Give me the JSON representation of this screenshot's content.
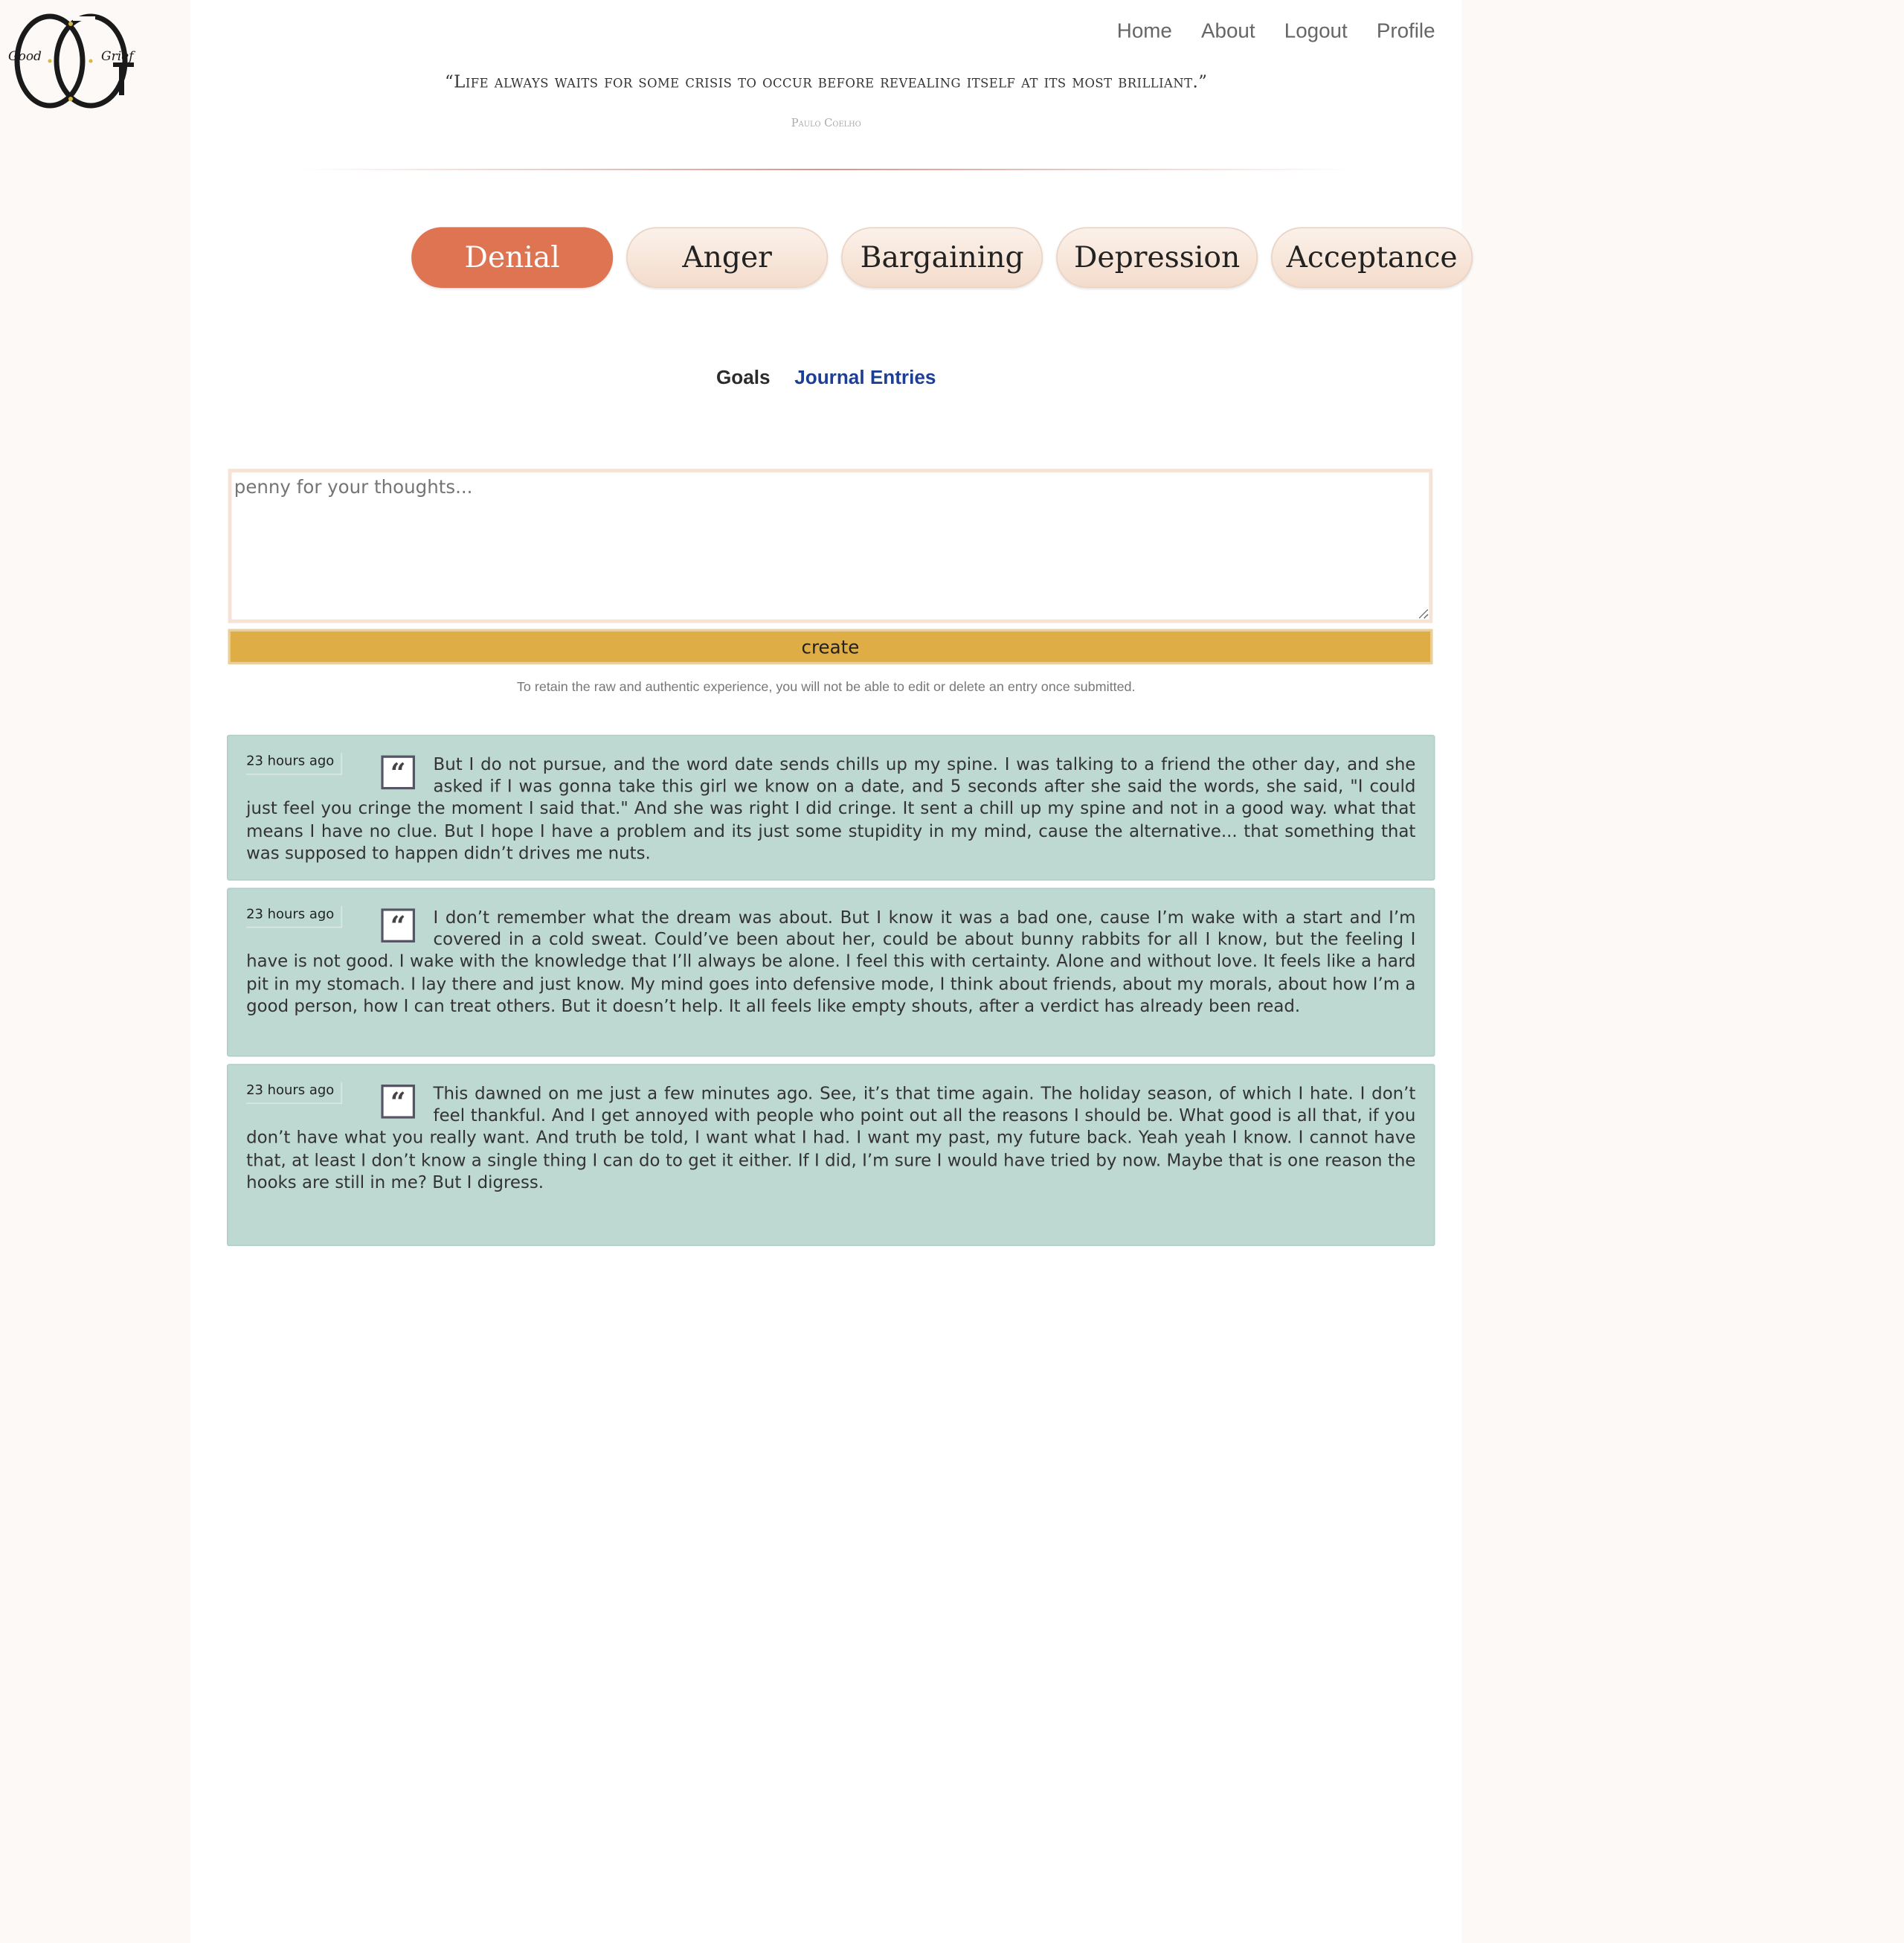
{
  "logo": {
    "left_text": "Good",
    "right_text": "Grief"
  },
  "nav": {
    "home": "Home",
    "about": "About",
    "logout": "Logout",
    "profile": "Profile"
  },
  "quote": {
    "text": "“Life always waits for some crisis to occur before revealing itself at its most brilliant.”",
    "author": "Paulo Coelho"
  },
  "stages": [
    "Denial",
    "Anger",
    "Bargaining",
    "Depression",
    "Acceptance"
  ],
  "active_stage": "Denial",
  "subtabs": {
    "goals": "Goals",
    "journal": "Journal Entries"
  },
  "entry_form": {
    "placeholder": "penny for your thoughts...",
    "value": "",
    "create_label": "create",
    "disclaimer": "To retain the raw and authentic experience, you will not be able to edit or delete an entry once submitted."
  },
  "entries": [
    {
      "time": "23 hours ago",
      "text": "But I do not pursue, and the word date sends chills up my spine. I was talking to a friend the other day, and she asked if I was gonna take this girl we know on a date, and 5 seconds after she said the words, she said, \"I could just feel you cringe the moment I said that.\" And she was right I did cringe. It sent a chill up my spine and not in a good way. what that means I have no clue. But I hope I have a problem and its just some stupidity in my mind, cause the alternative... that something that was supposed to happen didn’t drives me nuts."
    },
    {
      "time": "23 hours ago",
      "text": "I don’t remember what the dream was about. But I know it was a bad one, cause I’m wake with a start and I’m covered in a cold sweat. Could’ve been about her, could be about bunny rabbits for all I know, but the feeling I have is not good. I wake with the knowledge that I’ll always be alone. I feel this with certainty. Alone and without love. It feels like a hard pit in my stomach. I lay there and just know. My mind goes into defensive mode, I think about friends, about my morals, about how I’m a good person, how I can treat others. But it doesn’t help. It all feels like empty shouts, after a verdict has already been read."
    },
    {
      "time": "23 hours ago",
      "text": "This dawned on me just a few minutes ago. See, it’s that time again. The holiday season, of which I hate. I don’t feel thankful. And I get annoyed with people who point out all the reasons I should be. What good is all that, if you don’t have what you really want. And truth be told, I want what I had. I want my past, my future back. Yeah yeah I know. I cannot have that, at least I don’t know a single thing I can do to get it either. If I did, I’m sure I would have tried by now. Maybe that is one reason the hooks are still in me? But I digress."
    }
  ],
  "colors": {
    "accent": "#df7452",
    "button": "#dfad45",
    "entry_bg": "#bed8d2",
    "link": "#1d3f93"
  }
}
